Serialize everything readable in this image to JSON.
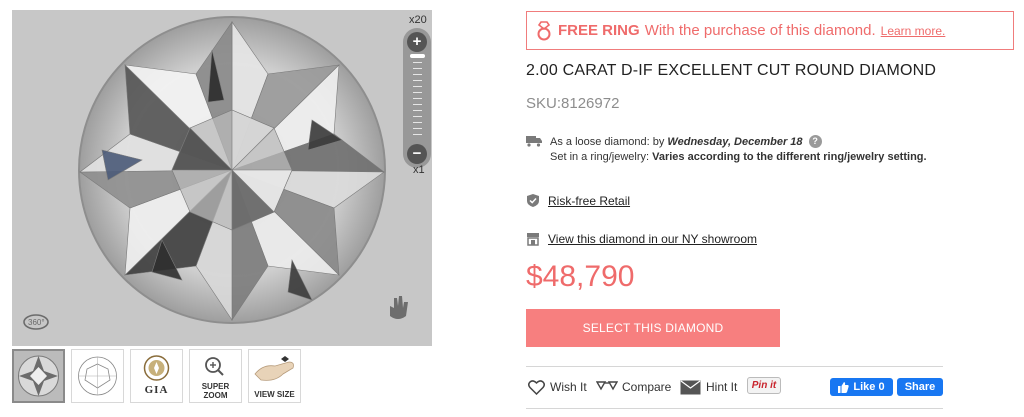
{
  "viewer": {
    "zoom_max_label": "x20",
    "zoom_min_label": "x1",
    "zoom_in_symbol": "+",
    "zoom_out_symbol": "−",
    "rotate_label": "360°",
    "icons": [
      "rotate-360-icon",
      "hand-drag-icon",
      "zoom-in-icon",
      "zoom-out-icon"
    ]
  },
  "thumbnails": [
    {
      "name": "diamond-photo",
      "caption": ""
    },
    {
      "name": "diamond-diagram",
      "caption": ""
    },
    {
      "name": "gia-certificate",
      "caption": "GIA"
    },
    {
      "name": "super-zoom",
      "caption_line1": "SUPER",
      "caption_line2": "ZOOM"
    },
    {
      "name": "view-size",
      "caption": "VIEW SIZE"
    }
  ],
  "promo": {
    "strong": "FREE RING",
    "text": "With the purchase of this diamond.",
    "link": "Learn more.",
    "icon": "ring-icon"
  },
  "product": {
    "title": "2.00 CARAT D-IF EXCELLENT CUT ROUND DIAMOND",
    "sku": "SKU:8126972",
    "price": "$48,790"
  },
  "shipping": {
    "loose_prefix": "As a loose diamond: by",
    "loose_date": "Wednesday, December 18",
    "help": "?",
    "ring_prefix": "Set in a ring/jewelry:",
    "ring_value": "Varies according to the different ring/jewelry setting.",
    "icon": "truck-icon"
  },
  "links": {
    "risk_free": "Risk-free Retail",
    "showroom": "View this diamond in our NY showroom"
  },
  "cta": {
    "label": "SELECT THIS DIAMOND"
  },
  "actions": {
    "wish": "Wish It",
    "compare": "Compare",
    "hint": "Hint It",
    "pin": "Pin it",
    "fb_like": "Like 0",
    "fb_share": "Share"
  },
  "colors": {
    "accent": "#ef6b6b",
    "cta": "#f77f7f",
    "facebook": "#1877f2"
  }
}
